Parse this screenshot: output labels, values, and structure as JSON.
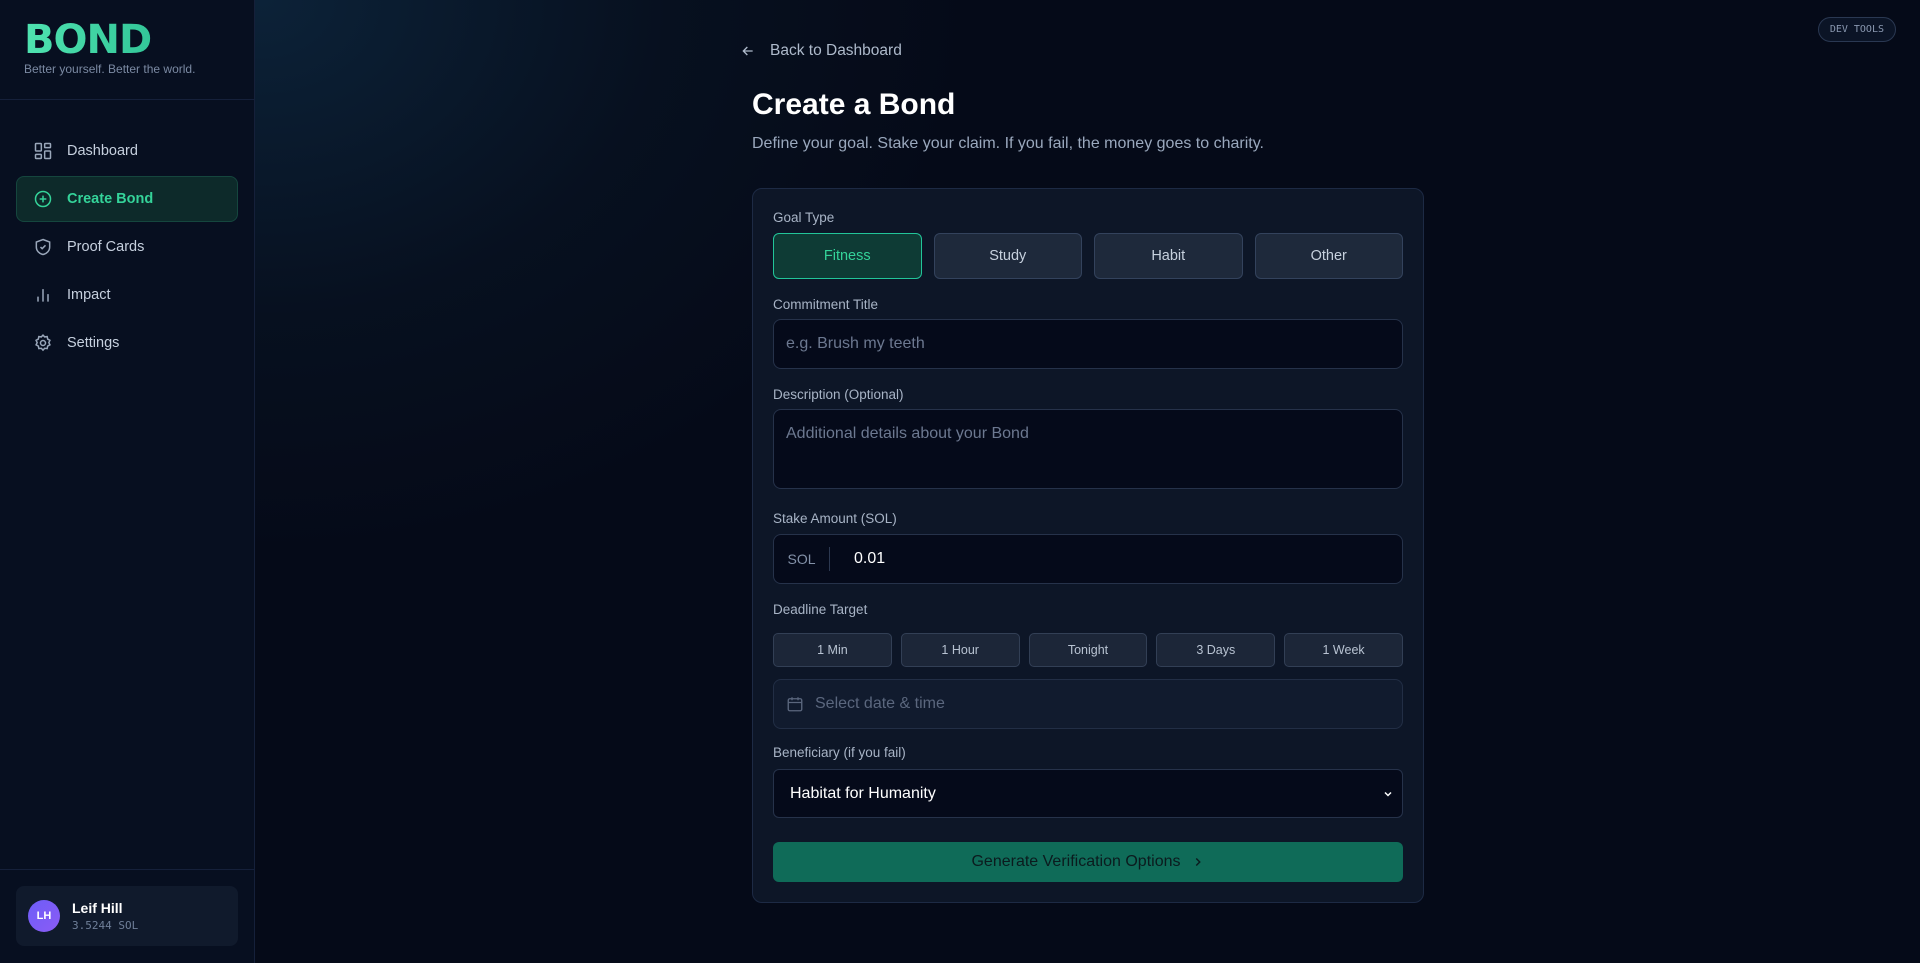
{
  "brand": {
    "logo": "BOND",
    "tagline": "Better yourself. Better the world."
  },
  "nav": {
    "items": [
      {
        "label": "Dashboard",
        "icon": "dashboard-grid-icon",
        "active": false
      },
      {
        "label": "Create Bond",
        "icon": "plus-circle-icon",
        "active": true
      },
      {
        "label": "Proof Cards",
        "icon": "shield-check-icon",
        "active": false
      },
      {
        "label": "Impact",
        "icon": "bar-chart-icon",
        "active": false
      },
      {
        "label": "Settings",
        "icon": "gear-icon",
        "active": false
      }
    ]
  },
  "user": {
    "initials": "LH",
    "name": "Leif Hill",
    "balance": "3.5244 SOL"
  },
  "devtools_label": "DEV TOOLS",
  "page": {
    "back_label": "Back to Dashboard",
    "title": "Create a Bond",
    "subtitle": "Define your goal. Stake your claim. If you fail, the money goes to charity."
  },
  "form": {
    "goal_type": {
      "label": "Goal Type",
      "options": [
        "Fitness",
        "Study",
        "Habit",
        "Other"
      ],
      "selected": "Fitness"
    },
    "title_field": {
      "label": "Commitment Title",
      "placeholder": "e.g. Brush my teeth",
      "value": ""
    },
    "description_field": {
      "label": "Description (Optional)",
      "placeholder": "Additional details about your Bond",
      "value": ""
    },
    "stake": {
      "label": "Stake Amount (SOL)",
      "prefix": "SOL",
      "value": "0.01"
    },
    "deadline": {
      "label": "Deadline Target",
      "presets": [
        "1 Min",
        "1 Hour",
        "Tonight",
        "3 Days",
        "1 Week"
      ],
      "placeholder": "Select date & time"
    },
    "beneficiary": {
      "label": "Beneficiary (if you fail)",
      "selected": "Habitat for Humanity"
    },
    "submit_label": "Generate Verification Options"
  },
  "colors": {
    "accent": "#34d399",
    "cta": "#0f6b58",
    "background": "#050a18"
  }
}
